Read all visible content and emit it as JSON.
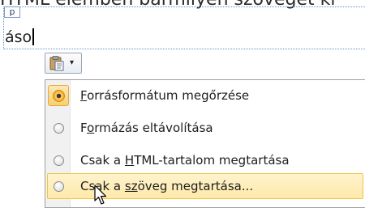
{
  "document": {
    "top_text": "HTML elemben bármilyen szöveget ki",
    "block_tag": "p",
    "edit_text": "áso"
  },
  "paste_button": {
    "icon": "clipboard-icon",
    "chevron": "▾"
  },
  "menu": {
    "items": [
      {
        "pre": "",
        "accel": "F",
        "post": "orrásformátum megőrzése",
        "selected": true,
        "hover": false
      },
      {
        "pre": "F",
        "accel": "o",
        "post": "rmázás eltávolítása",
        "selected": false,
        "hover": false
      },
      {
        "pre": "Csak a ",
        "accel": "H",
        "post": "TML-tartalom megtartása",
        "selected": false,
        "hover": false
      },
      {
        "pre": "Csak a ",
        "accel": "sz",
        "post": "öveg megtartása...",
        "selected": false,
        "hover": true
      }
    ]
  },
  "colors": {
    "hover_fill": "#fee9a8",
    "hover_border": "#f1c43f",
    "selected_radio": "#f5a623",
    "frame_border": "#6a8fc8"
  }
}
